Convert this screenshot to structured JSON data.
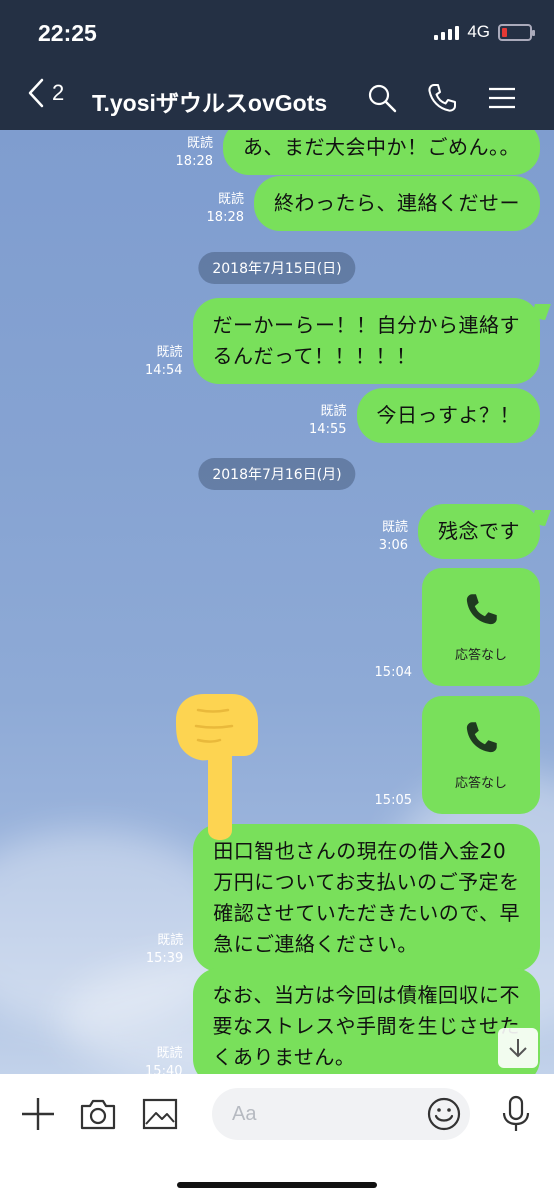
{
  "status_bar": {
    "time": "22:25",
    "network": "4G",
    "battery_percent": 10
  },
  "header": {
    "back_count": "2",
    "title": "T.yosiザウルスovGots"
  },
  "messages": [
    {
      "read": "既読",
      "time": "18:28",
      "text": "あ、まだ大会中か！ごめん。。"
    },
    {
      "read": "既読",
      "time": "18:28",
      "text": "終わったら、連絡くだせー"
    },
    {
      "date": "2018年7月15日(日)"
    },
    {
      "read": "既読",
      "time": "14:54",
      "text_lines": [
        "だーかーらー！！自分から連絡す",
        "るんだって！！！！！"
      ]
    },
    {
      "read": "既読",
      "time": "14:55",
      "text": "今日っすよ？！"
    },
    {
      "date": "2018年7月16日(月)"
    },
    {
      "read": "既読",
      "time": "3:06",
      "text": "残念です"
    },
    {
      "time": "15:04",
      "call_label": "応答なし"
    },
    {
      "time": "15:05",
      "call_label": "応答なし"
    },
    {
      "read": "既読",
      "time": "15:39",
      "text_lines": [
        "田口智也さんの現在の借入金20",
        "万円についてお支払いのご予定を",
        "確認させていただきたいので、早",
        "急にご連絡ください。"
      ]
    },
    {
      "read": "既読",
      "time": "15:40",
      "text_lines": [
        "なお、当方は今回は債権回収に不",
        "要なストレスや手間を生じさせた",
        "くありません。"
      ]
    }
  ],
  "input": {
    "placeholder": "Aa"
  },
  "icons": {
    "back": "chevron-left-icon",
    "search": "search-icon",
    "call": "phone-icon",
    "menu": "menu-icon",
    "plus": "plus-icon",
    "camera": "camera-icon",
    "image": "image-icon",
    "emoji": "emoji-icon",
    "mic": "microphone-icon",
    "scroll": "arrow-down-icon",
    "pointer": "pointing-hand-icon"
  },
  "colors": {
    "header_bg": "#243044",
    "bubble": "#79e05b",
    "battery_low": "#e53935"
  }
}
